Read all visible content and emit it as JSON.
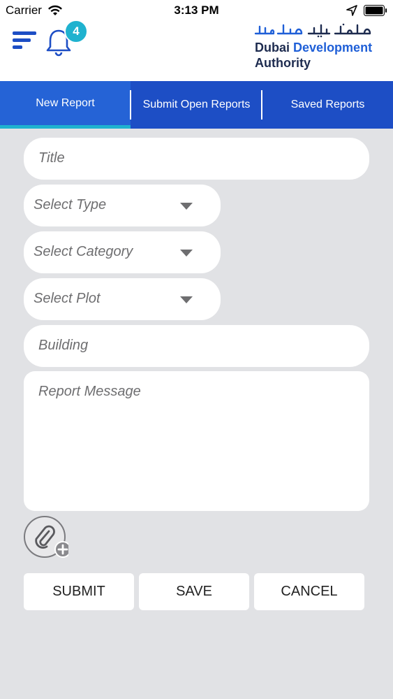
{
  "status_bar": {
    "carrier": "Carrier",
    "time": "3:13 PM"
  },
  "header": {
    "notification_count": "4",
    "logo_text_line1_part1": "Dubai",
    "logo_text_line1_part2": "Development",
    "logo_text_line2": "Authority"
  },
  "tabs": [
    {
      "label": "New Report",
      "active": true
    },
    {
      "label": "Submit Open Reports",
      "active": false
    },
    {
      "label": "Saved Reports",
      "active": false
    }
  ],
  "form": {
    "title_placeholder": "Title",
    "type_placeholder": "Select Type",
    "category_placeholder": "Select Category",
    "plot_placeholder": "Select Plot",
    "building_placeholder": "Building",
    "message_placeholder": "Report Message"
  },
  "buttons": {
    "submit": "SUBMIT",
    "save": "SAVE",
    "cancel": "CANCEL"
  },
  "colors": {
    "tab_bar": "#1d4ec5",
    "active_tab": "#2563d6",
    "accent": "#1fb2cf",
    "background": "#e1e2e5"
  }
}
